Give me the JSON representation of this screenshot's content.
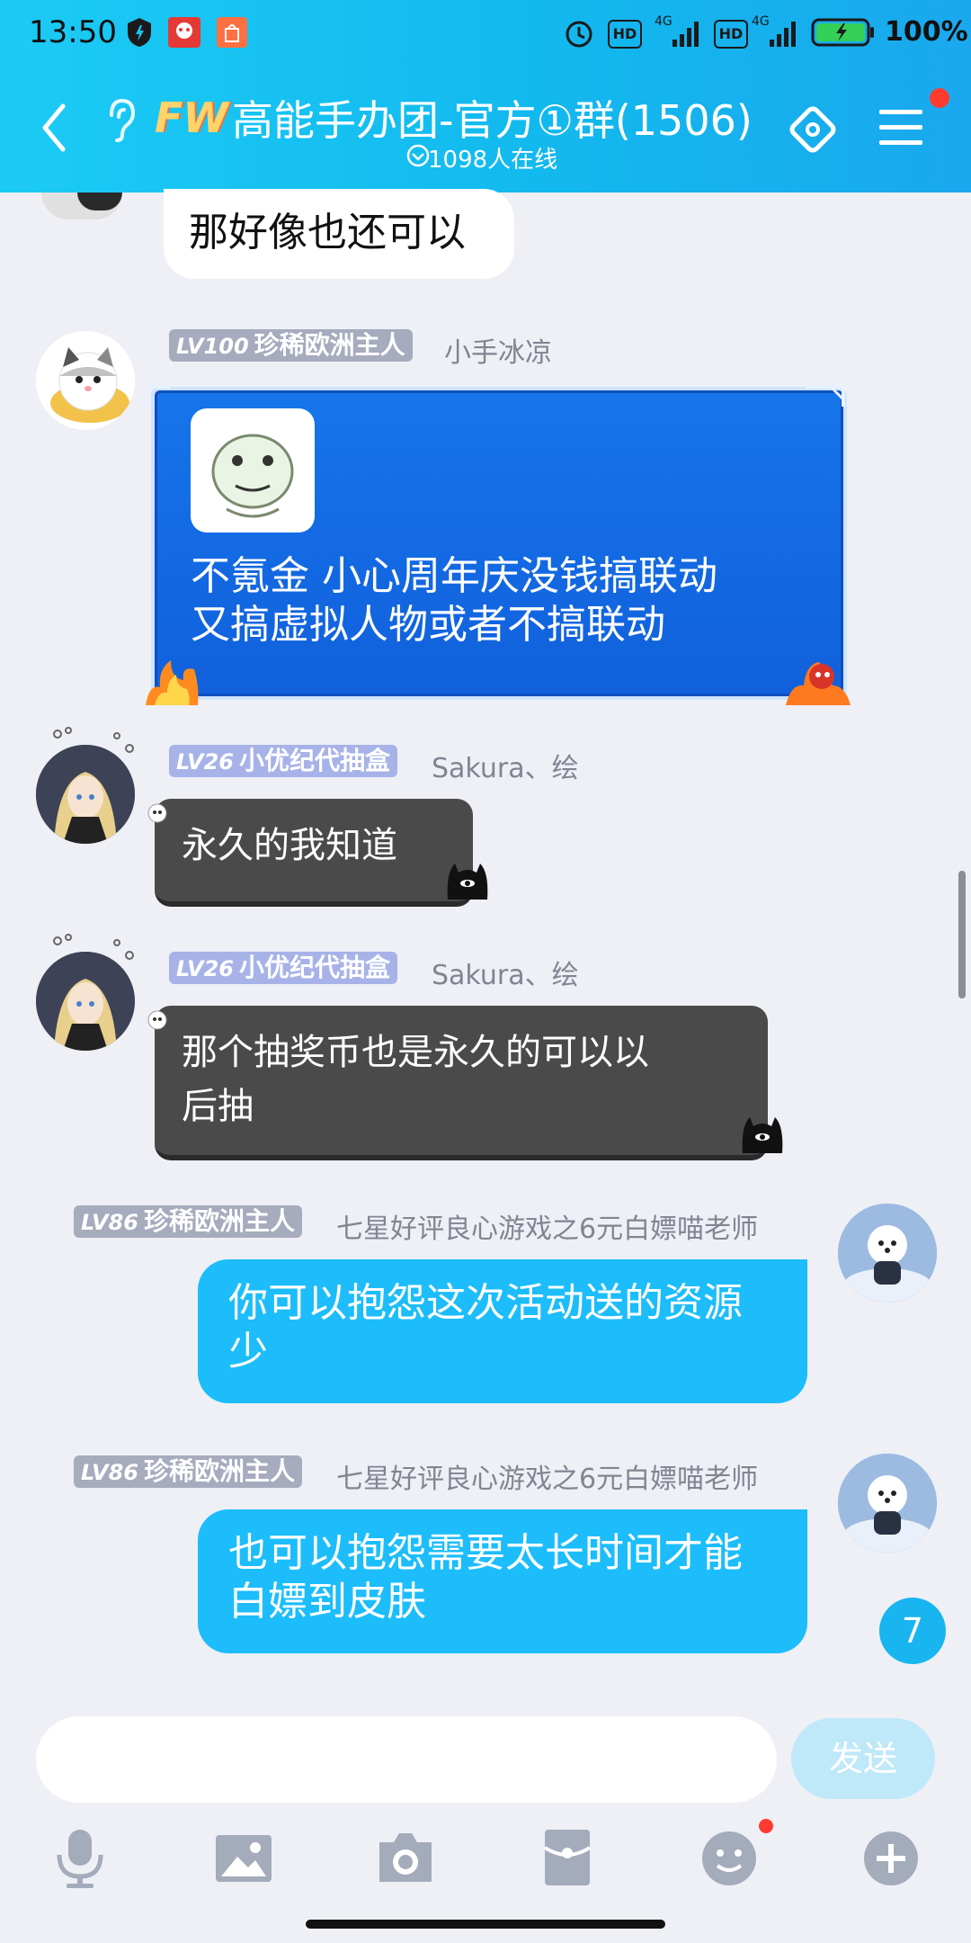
{
  "status_bar": {
    "time": "13:50",
    "network_1": "4G",
    "network_2": "4G",
    "hd_1": "HD",
    "hd_2": "HD",
    "battery": "100%"
  },
  "header": {
    "logo_text": "FW",
    "title": "高能手办团-官方①群(1506)",
    "online": "1098人在线"
  },
  "messages": [
    {
      "text": "那好像也还可以"
    },
    {
      "level": "LV100",
      "badge": "珍稀欧洲主人",
      "name": "小手冰凉",
      "text_line1": "不氪金 小心周年庆没钱搞联动",
      "text_line2": "又搞虚拟人物或者不搞联动"
    },
    {
      "level": "LV26",
      "badge": "小优纪代抽盒",
      "name": "Sakura、绘",
      "text": "永久的我知道"
    },
    {
      "level": "LV26",
      "badge": "小优纪代抽盒",
      "name": "Sakura、绘",
      "text_line1": "那个抽奖币也是永久的可以以",
      "text_line2": "后抽"
    },
    {
      "level": "LV86",
      "badge": "珍稀欧洲主人",
      "name": "七星好评良心游戏之6元白嫖喵老师",
      "text_line1": "你可以抱怨这次活动送的资源",
      "text_line2": "少"
    },
    {
      "level": "LV86",
      "badge": "珍稀欧洲主人",
      "name": "七星好评良心游戏之6元白嫖喵老师",
      "text_line1": "也可以抱怨需要太长时间才能",
      "text_line2": "白嫖到皮肤"
    }
  ],
  "unread_count": "7",
  "composer": {
    "send_label": "发送"
  },
  "colors": {
    "header": "#1cbdfa",
    "outgoing_bubble": "#1cbdfa",
    "special_bubble": "#1565e0"
  }
}
